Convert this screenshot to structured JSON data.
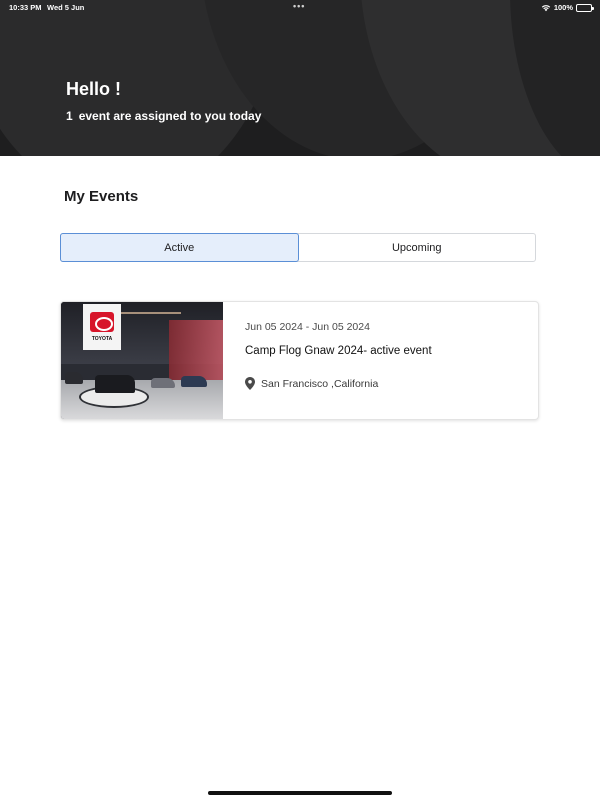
{
  "status_bar": {
    "time": "10:33 PM",
    "date": "Wed 5 Jun",
    "multitask_dots": "•••",
    "battery_percent": "100%",
    "icons": [
      "wifi-icon",
      "battery-icon"
    ]
  },
  "header": {
    "greeting": "Hello !",
    "assigned_count": "1",
    "assigned_text": "event are assigned to you today"
  },
  "events_section": {
    "title": "My Events",
    "tabs": [
      {
        "label": "Active",
        "selected": true
      },
      {
        "label": "Upcoming",
        "selected": false
      }
    ]
  },
  "events": [
    {
      "dates": "Jun 05 2024 - Jun 05 2024",
      "name": "Camp Flog Gnaw 2024- active event",
      "location": "San Francisco ,California",
      "location_icon": "location-pin-icon",
      "image_sign_text": "TOYOTA"
    }
  ],
  "colors": {
    "header_bg": "#1e1e1f",
    "active_tab_bg": "#e5eefb",
    "active_tab_border": "#5b8fd6"
  }
}
